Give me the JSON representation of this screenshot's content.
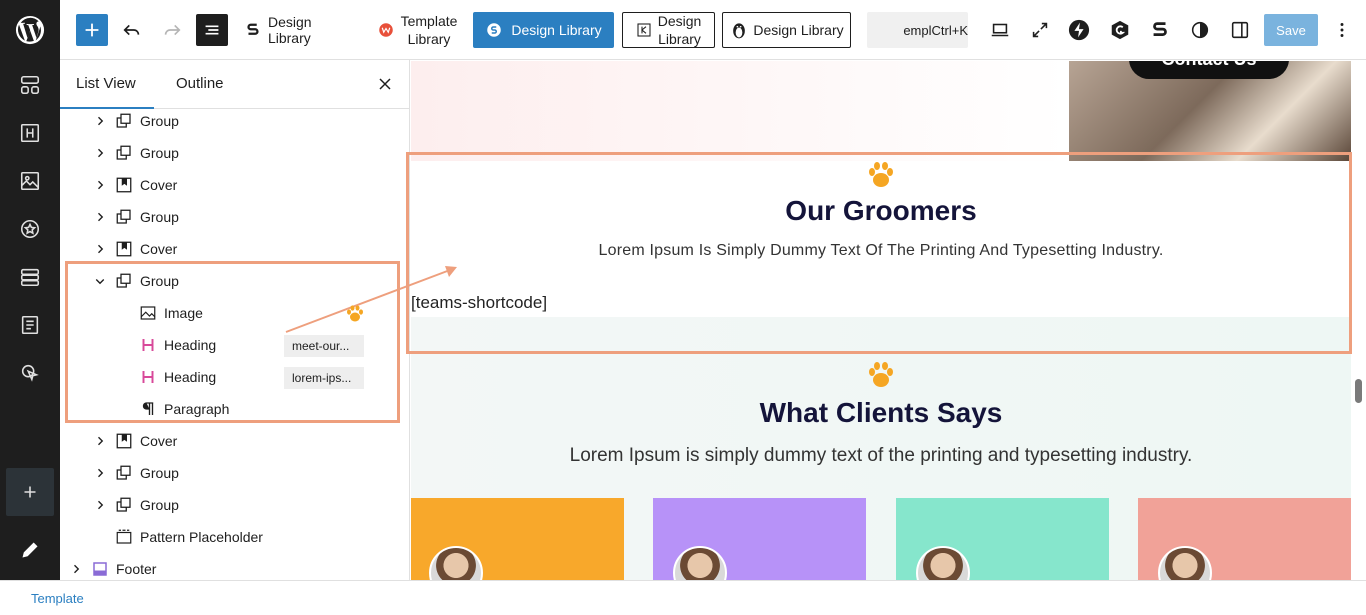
{
  "rail": {
    "items": [
      "wordpress-logo",
      "patterns-icon",
      "heading-icon",
      "image-icon",
      "badge-icon",
      "layout-icon",
      "form-icon",
      "cursor-icon",
      "plus-icon",
      "pencil-icon"
    ]
  },
  "toolbar": {
    "add_label": "+",
    "design_library_1": "Design Library",
    "template_library": "Template\nLibrary",
    "design_library_blue": "Design Library",
    "design_library_outline_1": "Design\nLibrary",
    "design_library_outline_2": "Design Library",
    "search_text": "empl",
    "search_shortcut": "Ctrl+K",
    "save_label": "Save"
  },
  "panel": {
    "tabs": [
      "List View",
      "Outline"
    ],
    "rows": [
      {
        "label": "Group",
        "icon": "group-icon",
        "indent": 0,
        "chev": "right"
      },
      {
        "label": "Group",
        "icon": "group-icon",
        "indent": 0,
        "chev": "right"
      },
      {
        "label": "Cover",
        "icon": "cover-icon",
        "indent": 0,
        "chev": "right"
      },
      {
        "label": "Group",
        "icon": "group-icon",
        "indent": 0,
        "chev": "right"
      },
      {
        "label": "Cover",
        "icon": "cover-icon",
        "indent": 0,
        "chev": "right"
      },
      {
        "label": "Group",
        "icon": "group-icon",
        "indent": 0,
        "chev": "down"
      },
      {
        "label": "Image",
        "icon": "image-icon",
        "indent": 1,
        "chev": ""
      },
      {
        "label": "Heading",
        "icon": "heading-icon",
        "indent": 1,
        "chev": "",
        "anchor": "meet-our..."
      },
      {
        "label": "Heading",
        "icon": "heading-icon",
        "indent": 1,
        "chev": "",
        "anchor": "lorem-ips..."
      },
      {
        "label": "Paragraph",
        "icon": "paragraph-icon",
        "indent": 1,
        "chev": ""
      },
      {
        "label": "Cover",
        "icon": "cover-icon",
        "indent": 0,
        "chev": "right"
      },
      {
        "label": "Group",
        "icon": "group-icon",
        "indent": 0,
        "chev": "right"
      },
      {
        "label": "Group",
        "icon": "group-icon",
        "indent": 0,
        "chev": "right"
      },
      {
        "label": "Pattern Placeholder",
        "icon": "pattern-placeholder-icon",
        "indent": 0,
        "chev": ""
      },
      {
        "label": "Footer",
        "icon": "footer-icon",
        "indent": -1,
        "chev": "right"
      }
    ]
  },
  "canvas": {
    "contact_label": "Contact Us",
    "groomers_title": "Our Groomers",
    "groomers_sub": "Lorem Ipsum Is Simply Dummy Text Of The Printing And Typesetting Industry.",
    "shortcode": "[teams-shortcode]",
    "clients_title": "What Clients Says",
    "clients_sub": "Lorem Ipsum is simply dummy text of the printing and typesetting industry.",
    "card_colors": [
      "#f8a82b",
      "#b792f8",
      "#86e6cc",
      "#f1a298"
    ]
  },
  "footer": {
    "breadcrumb": "Template"
  },
  "colors": {
    "accent": "#2b7fc1",
    "highlight": "#ee9f7d",
    "paw": "#f5a623",
    "heading_block": "#d8499a"
  }
}
